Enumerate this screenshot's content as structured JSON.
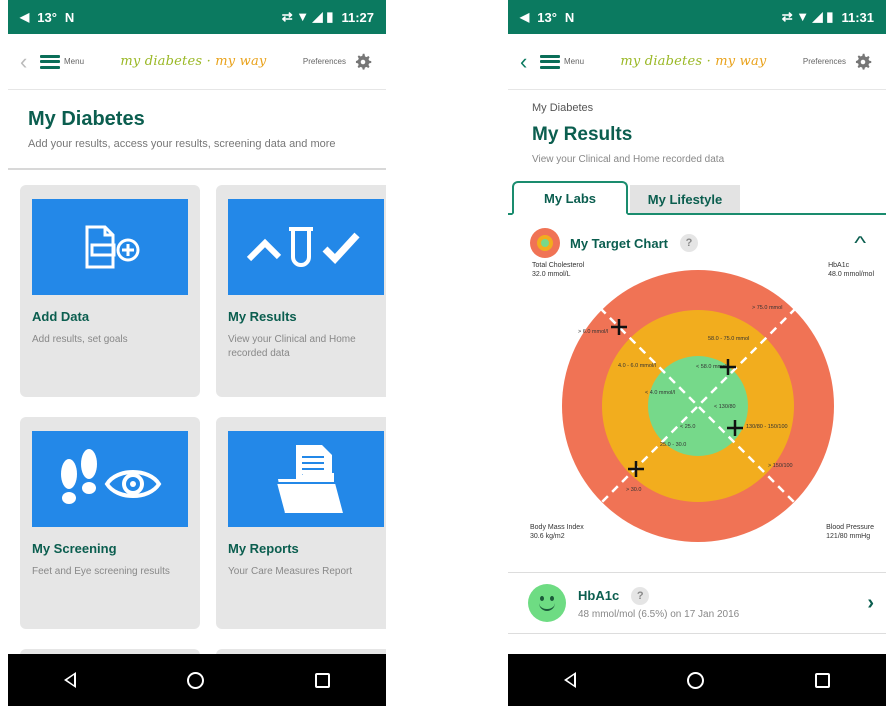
{
  "status": {
    "temp": "13°",
    "app_letter": "N",
    "time_left": "11:27",
    "time_right": "11:31"
  },
  "appbar": {
    "menu_label": "Menu",
    "brand_1": "my diabetes",
    "brand_2": "my way",
    "prefs_label": "Preferences"
  },
  "left": {
    "title": "My Diabetes",
    "subtitle": "Add your results, access your results, screening data and more",
    "tiles": [
      {
        "title": "Add Data",
        "desc": "Add results, set goals",
        "icon": "add-data-icon"
      },
      {
        "title": "My Results",
        "desc": "View your Clinical and Home recorded data",
        "icon": "results-graph-icon"
      },
      {
        "title": "My Screening",
        "desc": "Feet and Eye screening results",
        "icon": "footprints-eye-icon"
      },
      {
        "title": "My Reports",
        "desc": "Your Care Measures Report",
        "icon": "folder-document-icon"
      }
    ]
  },
  "right": {
    "breadcrumb": "My Diabetes",
    "title": "My Results",
    "subtitle": "View your Clinical and Home recorded data",
    "tabs": [
      "My Labs",
      "My Lifestyle"
    ],
    "target_title": "My Target Chart",
    "help": "?",
    "corners": {
      "tl_name": "Total Cholesterol",
      "tl_val": "32.0 mmol/L",
      "tr_name": "HbA1c",
      "tr_val": "48.0 mmol/mol",
      "bl_name": "Body Mass Index",
      "bl_val": "30.6 kg/m2",
      "br_name": "Blood Pressure",
      "br_val": "121/80 mmHg"
    },
    "zones": {
      "tl_outer": "> 6.0 mmol/l",
      "tl_mid": "4.0 - 6.0 mmol/l",
      "tl_inner": "< 4.0 mmol/l",
      "tr_outer": "> 75.0 mmol",
      "tr_mid": "58.0 - 75.0 mmol",
      "tr_inner": "< 58.0 mmol",
      "br_inner": "< 130/80",
      "br_mid": "130/80 - 150/100",
      "br_outer": "> 150/100",
      "bl_inner": "< 25.0",
      "bl_mid": "25.0 - 30.0",
      "bl_outer": "> 30.0"
    },
    "hba": {
      "name": "HbA1c",
      "value": "48 mmol/mol (6.5%) on 17 Jan 2016"
    }
  },
  "colors": {
    "header": "#0b7a60",
    "tile_blue": "#2388e8",
    "outer": "#f07355",
    "mid": "#f2ad1e",
    "inner": "#76d98a",
    "title": "#0b5e4f"
  }
}
